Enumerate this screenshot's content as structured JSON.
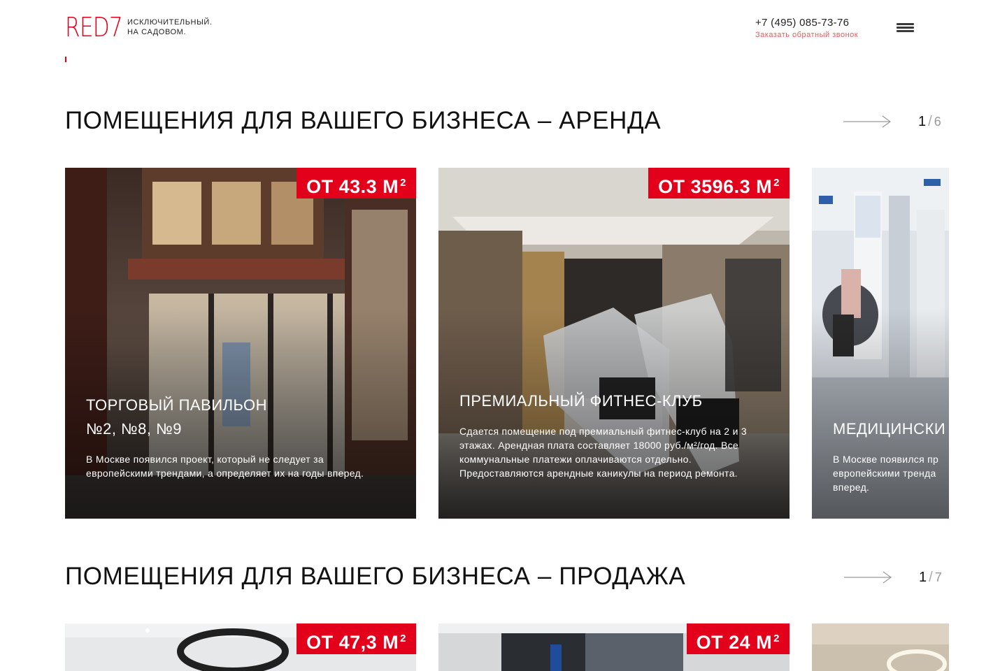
{
  "header": {
    "logo": "RED7",
    "tagline_line1": "ИСКЛЮЧИТЕЛЬНЫЙ.",
    "tagline_line2": "НА САДОВОМ.",
    "phone": "+7 (495) 085-73-76",
    "callback": "Заказать обратный звонок"
  },
  "rent": {
    "title": "ПОМЕЩЕНИЯ ДЛЯ ВАШЕГО БИЗНЕСА – АРЕНДА",
    "current": "1",
    "total": "6",
    "cards": [
      {
        "badge": "ОТ 43.3 М",
        "title_line1": "ТОРГОВЫЙ ПАВИЛЬОН",
        "title_line2": "№2, №8, №9",
        "description": "В Москве появился проект, который не следует за европейскими трендами, а определяет их на годы вперед."
      },
      {
        "badge": "ОТ 3596.3 М",
        "title_line1": "ПРЕМИАЛЬНЫЙ ФИТНЕС-КЛУБ",
        "description": "Сдается помещение под премиальный фитнес-клуб на 2 и 3 этажах. Арендная плата составляет 18000 руб./м²/год. Все коммунальные платежи оплачиваются отдельно. Предоставляются арендные каникулы на период ремонта."
      },
      {
        "title_line1": "МЕДИЦИНСКИ",
        "description_line1": "В Москве появился пр",
        "description_line2": "европейскими тренда",
        "description_line3": "вперед."
      }
    ]
  },
  "sale": {
    "title": "ПОМЕЩЕНИЯ ДЛЯ ВАШЕГО БИЗНЕСА – ПРОДАЖА",
    "current": "1",
    "total": "7",
    "cards": [
      {
        "badge": "ОТ 47,3 М"
      },
      {
        "badge": "ОТ 24 М"
      },
      {}
    ]
  },
  "badge_unit_sup": "2",
  "icons": {
    "menu": "hamburger-icon",
    "next": "arrow-right-icon"
  },
  "colors": {
    "brand_red": "#e3001b",
    "callback_link": "#e85a5a"
  }
}
